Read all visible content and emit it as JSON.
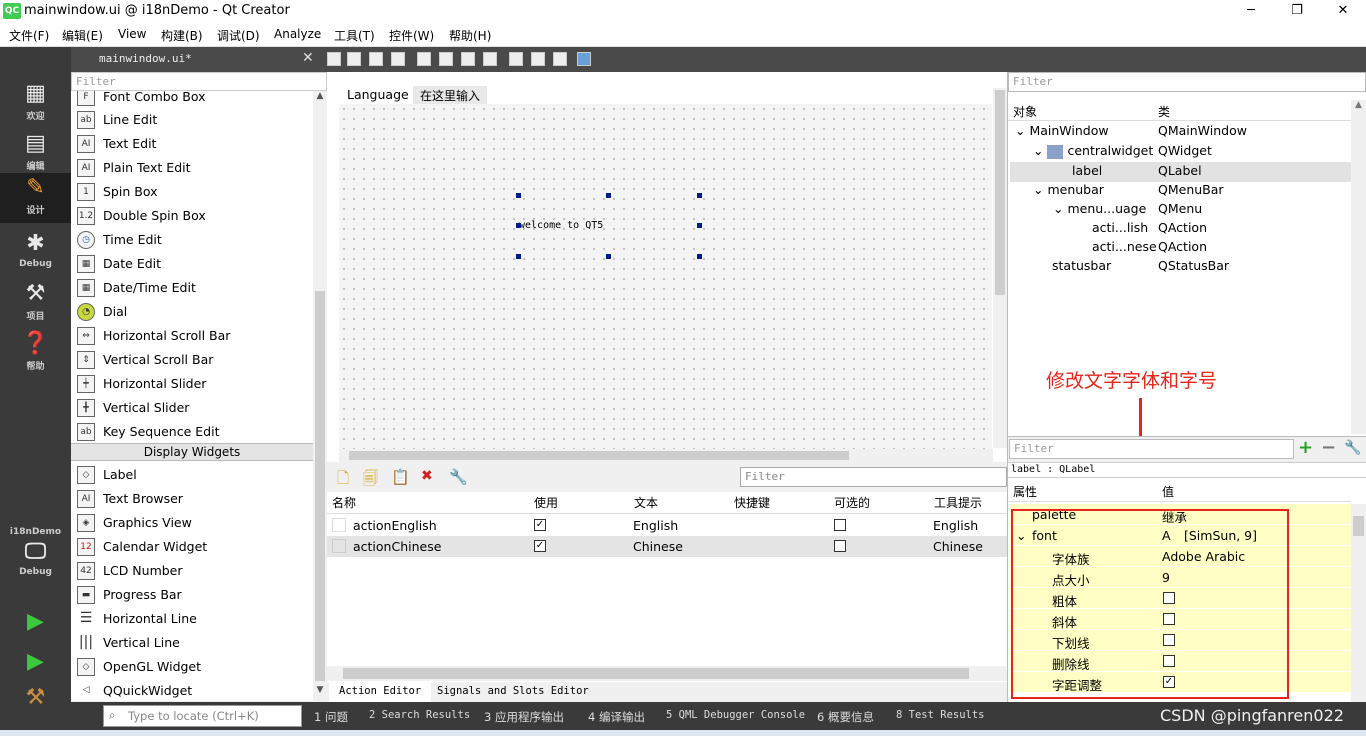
{
  "window": {
    "title": "mainwindow.ui @ i18nDemo - Qt Creator",
    "logo": "QC",
    "minimize": "─",
    "maximize": "❐",
    "close": "✕"
  },
  "menu": [
    "文件(F)",
    "编辑(E)",
    "View",
    "构建(B)",
    "调试(D)",
    "Analyze",
    "工具(T)",
    "控件(W)",
    "帮助(H)"
  ],
  "modes": [
    {
      "label": "欢迎",
      "icon": "grid-icon"
    },
    {
      "label": "编辑",
      "icon": "document-icon"
    },
    {
      "label": "设计",
      "icon": "pencil-icon"
    },
    {
      "label": "Debug",
      "icon": "bug-icon"
    },
    {
      "label": "项目",
      "icon": "wrench-icon"
    },
    {
      "label": "帮助",
      "icon": "help-icon"
    }
  ],
  "kit": {
    "project": "i18nDemo",
    "mode": "Debug"
  },
  "editor_tab": "mainwindow.ui*",
  "widgetbox": {
    "filter_placeholder": "Filter",
    "items_a": [
      "Font Combo Box",
      "Line Edit",
      "Text Edit",
      "Plain Text Edit",
      "Spin Box",
      "Double Spin Box",
      "Time Edit",
      "Date Edit",
      "Date/Time Edit",
      "Dial",
      "Horizontal Scroll Bar",
      "Vertical Scroll Bar",
      "Horizontal Slider",
      "Vertical Slider",
      "Key Sequence Edit"
    ],
    "category": "Display Widgets",
    "items_b": [
      "Label",
      "Text Browser",
      "Graphics View",
      "Calendar Widget",
      "LCD Number",
      "Progress Bar",
      "Horizontal Line",
      "Vertical Line",
      "OpenGL Widget",
      "QQuickWidget"
    ]
  },
  "form": {
    "menu_item": "Language",
    "menu_placeholder": "在这里输入",
    "label_text": "welcome to QT5"
  },
  "action_editor": {
    "filter_placeholder": "Filter",
    "headers": [
      "名称",
      "使用",
      "文本",
      "快捷键",
      "可选的",
      "工具提示"
    ],
    "rows": [
      {
        "name": "actionEnglish",
        "used": true,
        "text": "English",
        "shortcut": "",
        "checkable": false,
        "tooltip": "English"
      },
      {
        "name": "actionChinese",
        "used": true,
        "text": "Chinese",
        "shortcut": "",
        "checkable": false,
        "tooltip": "Chinese"
      }
    ],
    "tabs": [
      "Action Editor",
      "Signals and Slots Editor"
    ]
  },
  "object_inspector": {
    "filter_placeholder": "Filter",
    "headers": [
      "对象",
      "类"
    ],
    "rows": [
      {
        "obj": "MainWindow",
        "cls": "QMainWindow"
      },
      {
        "obj": "centralwidget",
        "cls": "QWidget"
      },
      {
        "obj": "label",
        "cls": "QLabel"
      },
      {
        "obj": "menubar",
        "cls": "QMenuBar"
      },
      {
        "obj": "menu...uage",
        "cls": "QMenu"
      },
      {
        "obj": "acti...lish",
        "cls": "QAction"
      },
      {
        "obj": "acti...nese",
        "cls": "QAction"
      },
      {
        "obj": "statusbar",
        "cls": "QStatusBar"
      }
    ]
  },
  "property_editor": {
    "filter_placeholder": "Filter",
    "context": "label : QLabel",
    "headers": [
      "属性",
      "值"
    ],
    "rows": [
      {
        "name": "palette",
        "value": "继承"
      },
      {
        "name": "font",
        "value": "[SimSun, 9]"
      },
      {
        "name": "字体族",
        "value": "Adobe Arabic"
      },
      {
        "name": "点大小",
        "value": "9"
      },
      {
        "name": "粗体",
        "value": ""
      },
      {
        "name": "斜体",
        "value": ""
      },
      {
        "name": "下划线",
        "value": ""
      },
      {
        "name": "删除线",
        "value": ""
      },
      {
        "name": "字距调整",
        "value": ""
      }
    ]
  },
  "annotation": "修改文字字体和字号",
  "statusbar": {
    "locator_placeholder": "Type to locate (Ctrl+K)",
    "panes": [
      "1 问题",
      "2 Search Results",
      "3 应用程序输出",
      "4 编译输出",
      "5 QML Debugger Console",
      "6 概要信息",
      "8 Test Results"
    ]
  },
  "watermark": "CSDN @pingfanren022"
}
